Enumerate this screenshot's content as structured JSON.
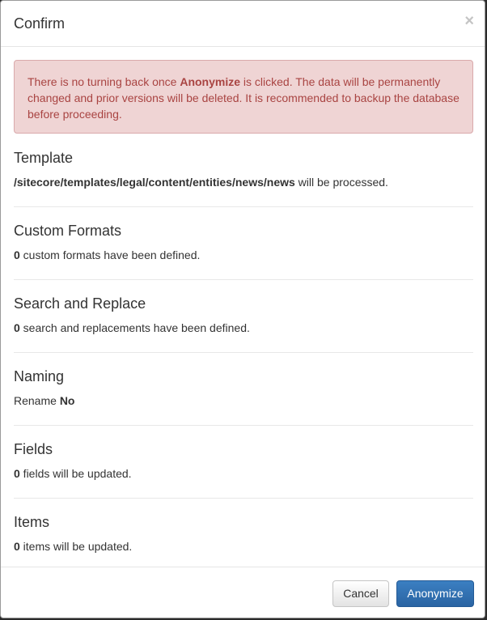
{
  "modal": {
    "title": "Confirm",
    "close_symbol": "×"
  },
  "alert": {
    "prefix": "There is no turning back once ",
    "strong": "Anonymize",
    "suffix": " is clicked. The data will be permanently changed and prior versions will be deleted. It is recommended to backup the database before proceeding."
  },
  "sections": {
    "template": {
      "heading": "Template",
      "strong": "/sitecore/templates/legal/content/entities/news/news",
      "text": " will be processed."
    },
    "custom_formats": {
      "heading": "Custom Formats",
      "strong": "0",
      "text": " custom formats have been defined."
    },
    "search_replace": {
      "heading": "Search and Replace",
      "strong": "0",
      "text": " search and replacements have been defined."
    },
    "naming": {
      "heading": "Naming",
      "text": "Rename ",
      "strong": "No"
    },
    "fields": {
      "heading": "Fields",
      "strong": "0",
      "text": " fields will be updated."
    },
    "items": {
      "heading": "Items",
      "strong": "0",
      "text": " items will be updated."
    }
  },
  "footer": {
    "cancel_label": "Cancel",
    "confirm_label": "Anonymize"
  }
}
